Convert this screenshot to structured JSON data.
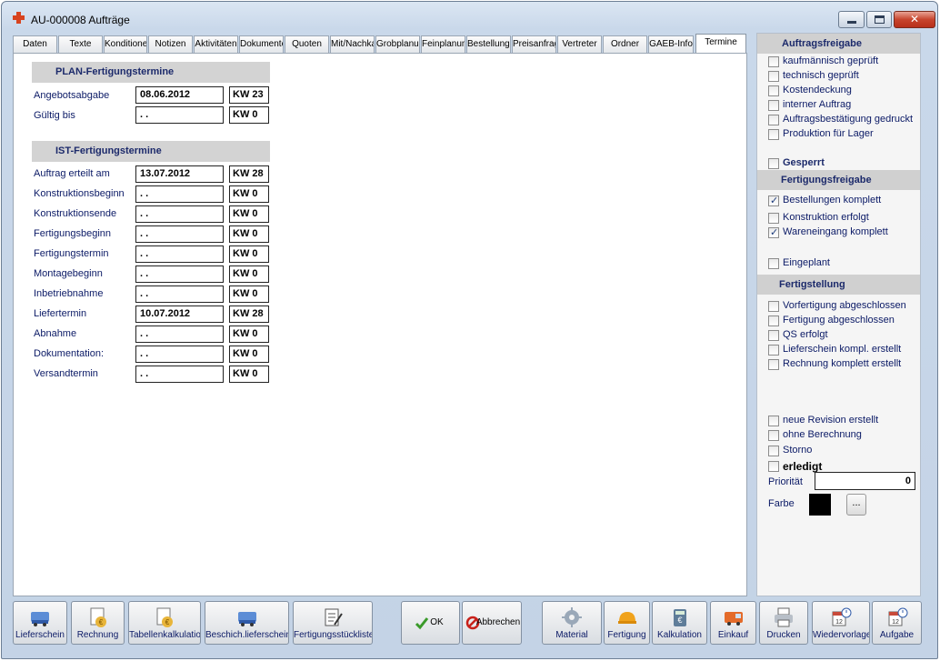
{
  "window": {
    "title": "AU-000008 Aufträge"
  },
  "tabs": [
    "Daten",
    "Texte",
    "Konditionen",
    "Notizen",
    "Aktivitäten",
    "Dokumente",
    "Quoten",
    "Mit/Nachkalk",
    "Grobplanung",
    "Feinplanung",
    "Bestellungen",
    "Preisanfragen",
    "Vertreter",
    "Ordner",
    "GAEB-Info",
    "Termine"
  ],
  "active_tab": "Termine",
  "plan": {
    "title": "PLAN-Fertigungstermine",
    "rows": [
      {
        "label": "Angebotsabgabe",
        "date": "08.06.2012",
        "kw": "KW 23"
      },
      {
        "label": "Gültig bis",
        "date": " . .",
        "kw": "KW 0"
      }
    ]
  },
  "ist": {
    "title": "IST-Fertigungstermine",
    "rows": [
      {
        "label": "Auftrag erteilt am",
        "date": "13.07.2012",
        "kw": "KW 28"
      },
      {
        "label": "Konstruktionsbeginn",
        "date": " . .",
        "kw": "KW 0"
      },
      {
        "label": "Konstruktionsende",
        "date": " . .",
        "kw": "KW 0"
      },
      {
        "label": "Fertigungsbeginn",
        "date": " . .",
        "kw": "KW 0"
      },
      {
        "label": "Fertigungstermin",
        "date": " . .",
        "kw": "KW 0"
      },
      {
        "label": "Montagebeginn",
        "date": " . .",
        "kw": "KW 0"
      },
      {
        "label": "Inbetriebnahme",
        "date": " . .",
        "kw": "KW 0"
      },
      {
        "label": "Liefertermin",
        "date": "10.07.2012",
        "kw": "KW 28"
      },
      {
        "label": "Abnahme",
        "date": " . .",
        "kw": "KW 0"
      },
      {
        "label": "Dokumentation:",
        "date": " . .",
        "kw": "KW 0"
      },
      {
        "label": "Versandtermin",
        "date": " . .",
        "kw": "KW 0"
      }
    ]
  },
  "right": {
    "auftragsfreigabe": {
      "title": "Auftragsfreigabe",
      "items": [
        {
          "label": "kaufmännisch geprüft",
          "checked": false
        },
        {
          "label": "technisch geprüft",
          "checked": false
        },
        {
          "label": "Kostendeckung",
          "checked": false
        },
        {
          "label": "interner Auftrag",
          "checked": false
        },
        {
          "label": "Auftragsbestätigung gedruckt",
          "checked": false
        },
        {
          "label": "Produktion für Lager",
          "checked": false
        }
      ]
    },
    "gesperrt": {
      "label": "Gesperrt",
      "checked": false
    },
    "fertigungsfreigabe": {
      "title": "Fertigungsfreigabe",
      "items": [
        {
          "label": "Bestellungen komplett",
          "checked": true
        },
        {
          "label": "Konstruktion erfolgt",
          "checked": false
        },
        {
          "label": "Wareneingang komplett",
          "checked": true
        }
      ]
    },
    "eingeplant": {
      "label": "Eingeplant",
      "checked": false
    },
    "fertigstellung": {
      "title": "Fertigstellung",
      "items": [
        {
          "label": "Vorfertigung abgeschlossen",
          "checked": false
        },
        {
          "label": "Fertigung abgeschlossen",
          "checked": false
        },
        {
          "label": "QS erfolgt",
          "checked": false
        },
        {
          "label": "Lieferschein kompl. erstellt",
          "checked": false
        },
        {
          "label": "Rechnung komplett erstellt",
          "checked": false
        }
      ]
    },
    "misc": [
      {
        "label": "neue Revision erstellt",
        "checked": false
      },
      {
        "label": "ohne Berechnung",
        "checked": false
      },
      {
        "label": "Storno",
        "checked": false
      }
    ],
    "erledigt": {
      "label": "erledigt",
      "checked": false
    },
    "prioritaet": {
      "label": "Priorität",
      "value": "0"
    },
    "farbe": {
      "label": "Farbe",
      "color": "#000000",
      "button": "..."
    }
  },
  "toolbar": {
    "lieferschein": "Lieferschein",
    "rechnung": "Rechnung",
    "tabellenkalkulation": "Tabellenkalkulation",
    "beschichlieferschein": "Beschich.lieferschein",
    "fertigungsstueckliste": "Fertigungsstückliste",
    "ok": "OK",
    "abbrechen": "Abbrechen",
    "material": "Material",
    "fertigung": "Fertigung",
    "kalkulation": "Kalkulation",
    "einkauf": "Einkauf",
    "drucken": "Drucken",
    "wiedervorlage": "Wiedervorlage",
    "aufgabe": "Aufgabe"
  },
  "colors": {
    "accent_blue": "#0b1a66",
    "section_bg": "#d3d3d3",
    "checkmark": "#1c3b7c"
  }
}
